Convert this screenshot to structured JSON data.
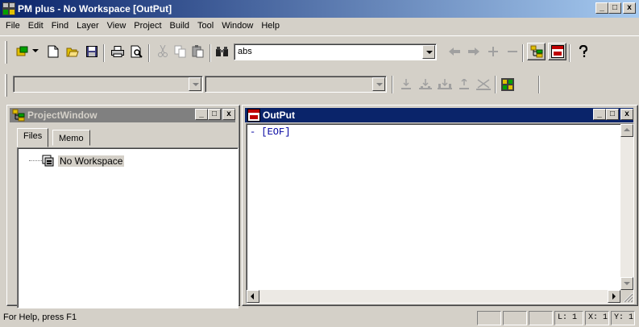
{
  "window": {
    "title": "PM plus - No Workspace [OutPut]",
    "min_label": "_",
    "max_label": "□",
    "close_label": "x"
  },
  "menu": [
    "File",
    "Edit",
    "Find",
    "Layer",
    "View",
    "Project",
    "Build",
    "Tool",
    "Window",
    "Help"
  ],
  "toolbar": {
    "search_value": "abs"
  },
  "project_window": {
    "title": "ProjectWindow",
    "tabs": [
      "Files",
      "Memo"
    ],
    "active_tab": "Files",
    "tree_item": "No Workspace"
  },
  "output_window": {
    "title": "OutPut",
    "content": "- [EOF]"
  },
  "statusbar": {
    "help_text": "For Help, press F1",
    "line": "L: 1",
    "x": "X: 1",
    "y": "Y: 1"
  },
  "colors": {
    "active_title": "#0a246a",
    "inactive_title": "#808080",
    "face": "#d4d0c8",
    "output_text": "#0000a0"
  }
}
